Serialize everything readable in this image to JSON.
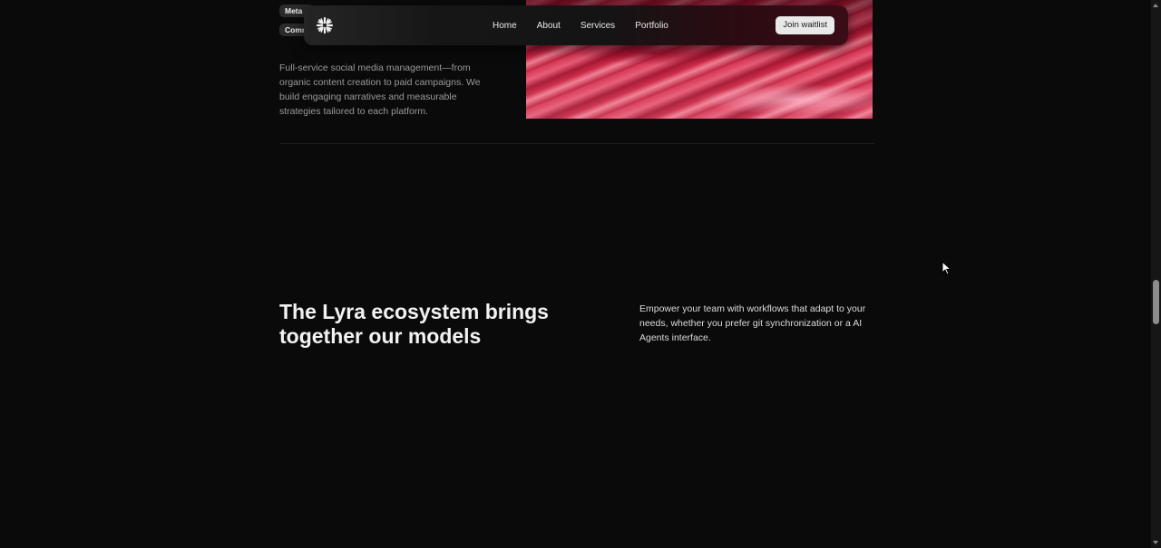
{
  "nav": {
    "logo_icon": "asterisk-burst-icon",
    "links": [
      "Home",
      "About",
      "Services",
      "Portfolio"
    ],
    "cta_label": "Join waitlist"
  },
  "service_card": {
    "tags": [
      "Meta",
      "Comm"
    ],
    "description": "Full-service social media management—from organic content creation to paid campaigns. We build engaging narratives and measurable strategies tailored to each platform."
  },
  "ecosystem": {
    "heading": "The Lyra ecosystem brings together our models",
    "body": "Empower your team with workflows that adapt to your needs, whether you prefer git synchronization or a AI Agents interface."
  },
  "colors": {
    "background": "#0b0a0b",
    "accent": "#d4324f",
    "cta_bg": "#e9e9e9"
  }
}
